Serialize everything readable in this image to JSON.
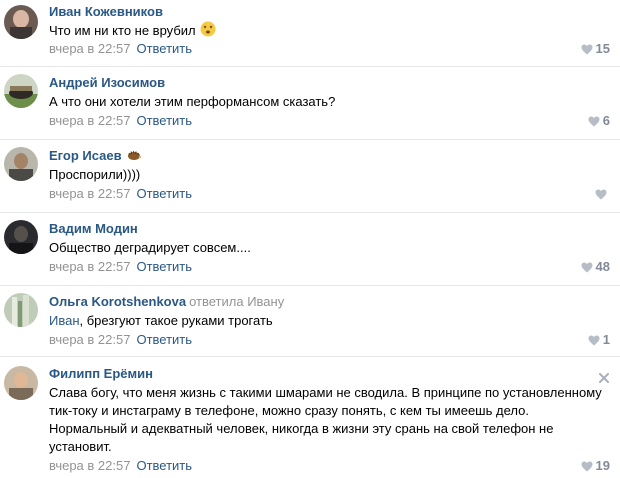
{
  "comments": [
    {
      "author": "Иван Кожевников",
      "text": "Что им ни кто не врубил",
      "emoji": "😵",
      "time": "вчера в 22:57",
      "reply_label": "Ответить",
      "likes": "15"
    },
    {
      "author": "Андрей Изосимов",
      "text": "А что они хотели этим перформансом сказать?",
      "time": "вчера в 22:57",
      "reply_label": "Ответить",
      "likes": "6"
    },
    {
      "author": "Егор Исаев",
      "badge": "🦔",
      "text": "Проспорили))))",
      "time": "вчера в 22:57",
      "reply_label": "Ответить",
      "likes": ""
    },
    {
      "author": "Вадим Модин",
      "text": "Общество деградирует совсем....",
      "time": "вчера в 22:57",
      "reply_label": "Ответить",
      "likes": "48"
    },
    {
      "author": "Ольга Korotshenkova",
      "replied": "ответила",
      "reply_to": "Ивану",
      "mention": "Иван",
      "text": ", брезгуют такое руками трогать",
      "time": "вчера в 22:57",
      "reply_label": "Ответить",
      "likes": "1"
    },
    {
      "author": "Филипп Ерёмин",
      "text": "Слава богу, что меня жизнь с такими шмарами не сводила. В принципе по установленному тик-току и инстаграму в телефоне, можно сразу понять, с кем ты имеешь дело. Нормальный и адекватный человек, никогда в жизни эту срань на свой телефон не установит.",
      "time": "вчера в 22:57",
      "reply_label": "Ответить",
      "likes": "19"
    }
  ],
  "colors": {
    "link": "#2a5885",
    "meta": "#939393",
    "like_icon": "#b7bdc6"
  }
}
